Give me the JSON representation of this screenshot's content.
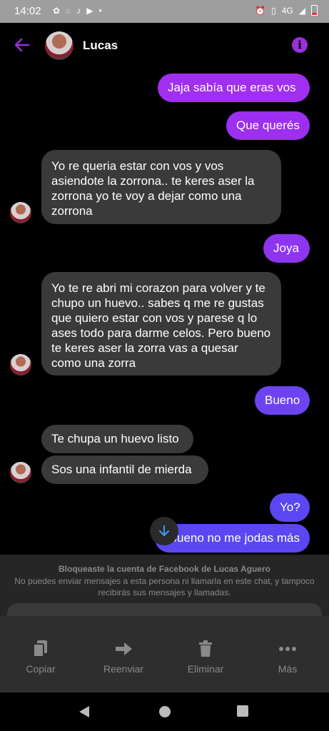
{
  "status_bar": {
    "time": "14:02",
    "network": "4G"
  },
  "header": {
    "contact_name": "Lucas"
  },
  "colors": {
    "accent_purple": "#9b2fd8",
    "outgoing_gradient_top": "#a12ff0",
    "outgoing_gradient_bottom": "#5a47f2",
    "incoming_bubble": "#3a3a3a"
  },
  "messages": [
    {
      "side": "out",
      "text": "Jaja sabía que eras vos"
    },
    {
      "side": "out",
      "text": "Que querés"
    },
    {
      "side": "in",
      "text": "Yo re queria estar con vos y vos asiendote la zorrona.. te keres aser la zorrona yo te voy a dejar como una zorrona"
    },
    {
      "side": "out",
      "text": "Joya"
    },
    {
      "side": "in",
      "text": "Yo te re abri mi corazon para volver y te chupo un huevo.. sabes q me re gustas que quiero estar con vos y parese q lo ases todo para darme celos. Pero bueno te keres aser la zorra vas a quesar como una zorra"
    },
    {
      "side": "out",
      "text": "Bueno"
    },
    {
      "side": "in",
      "text": "Te chupa un huevo listo"
    },
    {
      "side": "in",
      "text": "Sos una infantil de mierda"
    },
    {
      "side": "out",
      "text": "Yo?"
    },
    {
      "side": "out",
      "text": "Bueno no me jodas más"
    }
  ],
  "blocked_notice": {
    "title": "Bloqueaste la cuenta de Facebook de Lucas Aguero",
    "body": "No puedes enviar mensajes a esta persona ni llamarla en este chat, y tampoco recibirás sus mensajes y llamadas."
  },
  "actions": {
    "copy": "Copiar",
    "forward": "Reenviar",
    "delete": "Eliminar",
    "more": "Más"
  }
}
